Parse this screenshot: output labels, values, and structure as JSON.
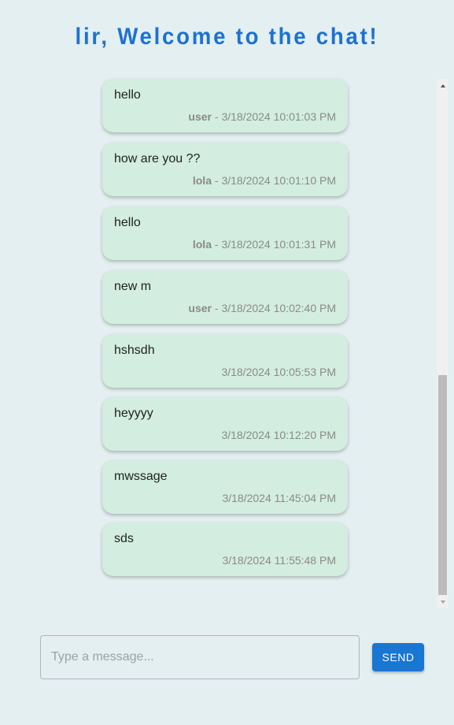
{
  "header": {
    "title": "lir, Welcome to the chat!"
  },
  "messages": [
    {
      "text": "hello",
      "user": "user",
      "separator": " - ",
      "timestamp": "3/18/2024 10:01:03 PM"
    },
    {
      "text": "how are you ??",
      "user": "lola",
      "separator": " - ",
      "timestamp": "3/18/2024 10:01:10 PM"
    },
    {
      "text": "hello",
      "user": "lola",
      "separator": " - ",
      "timestamp": "3/18/2024 10:01:31 PM"
    },
    {
      "text": "new m",
      "user": "user",
      "separator": " - ",
      "timestamp": "3/18/2024 10:02:40 PM"
    },
    {
      "text": "hshsdh",
      "user": "",
      "separator": "",
      "timestamp": "3/18/2024 10:05:53 PM"
    },
    {
      "text": "heyyyy",
      "user": "",
      "separator": "",
      "timestamp": "3/18/2024 10:12:20 PM"
    },
    {
      "text": "mwssage",
      "user": "",
      "separator": "",
      "timestamp": "3/18/2024 11:45:04 PM"
    },
    {
      "text": "sds",
      "user": "",
      "separator": "",
      "timestamp": "3/18/2024 11:55:48 PM"
    }
  ],
  "composer": {
    "placeholder": "Type a message...",
    "value": "",
    "send_label": "SEND"
  },
  "colors": {
    "background": "#e3eff0",
    "accent": "#1976d2",
    "title": "#1d72d0",
    "bubble": "#d3ede1"
  }
}
